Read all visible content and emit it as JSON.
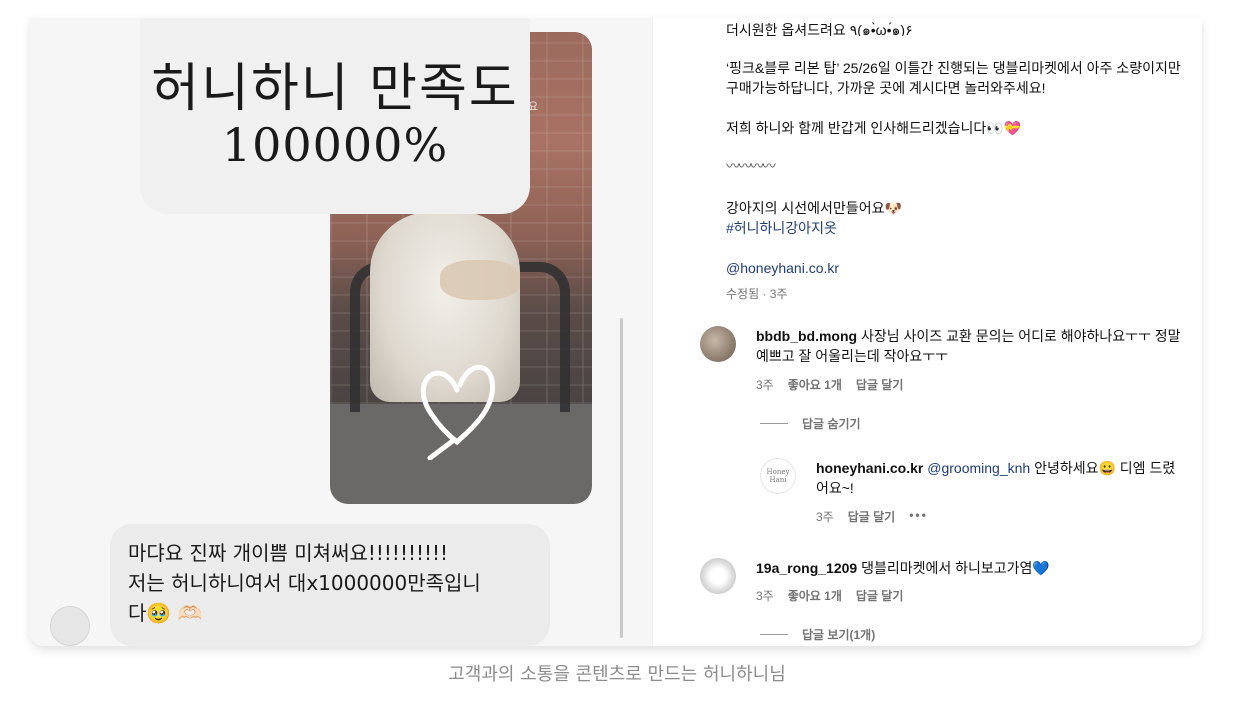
{
  "left": {
    "title_line1": "허니하니 만족도",
    "title_line2": "100000%",
    "story_tag": "요",
    "message_line1": "마댜요 진짜 개이쁨 미쳐써요!!!!!!!!!!",
    "message_line2": "저는 허니하니여서 대x1000000만족입니",
    "message_line3": "다🥹 🫶🏻"
  },
  "post": {
    "line_top": "더시원한 옵셔드려요 ٩(๑•̀ω•́๑)۶",
    "para1": "‘핑크&블루 리본 탑’ 25/26일 이틀간 진행되는 댕블리마켓에서 아주 소량이지만 구매가능하답니다, 가까운 곳에 계시다면 놀러와주세요!",
    "para2": "저희 하니와 함께 반갑게 인사해드리겠습니다👀💝",
    "squiggle": "〰〰〰〰",
    "para3": "강아지의 시선에서만들어요🐶",
    "hashtag": "#허니하니강아지옷",
    "mention": "@honeyhani.co.kr",
    "edited_meta": "수정됨 · 3주"
  },
  "comments": [
    {
      "user": "bbdb_bd.mong",
      "text": " 사장님 사이즈 교환 문의는 어디로 해야하나요ㅜㅜ 정말 예쁘고 잘 어울리는데 작아요ㅜㅜ",
      "time": "3주",
      "likes": "좋아요 1개",
      "reply": "답글 달기",
      "toggle": "답글 숨기기"
    },
    {
      "user": "honeyhani.co.kr",
      "mention": "@grooming_knh",
      "text": " 안녕하세요😀 디엠 드렸어요~!",
      "time": "3주",
      "reply": "답글 달기",
      "more": "•••",
      "avatar_text": "Honey Hani"
    },
    {
      "user": "19a_rong_1209",
      "text": " 댕블리마켓에서 하니보고가염💙",
      "time": "3주",
      "likes": "좋아요 1개",
      "reply": "답글 달기",
      "toggle": "답글 보기(1개)"
    }
  ],
  "like_icon": "♡",
  "figure_caption": "고객과의 소통을 콘텐츠로 만드는 허니하니님",
  "colors": {
    "link": "#1f3d7a",
    "meta": "#737373",
    "bubble": "#ebebeb",
    "story_bg": "#6b6868"
  }
}
